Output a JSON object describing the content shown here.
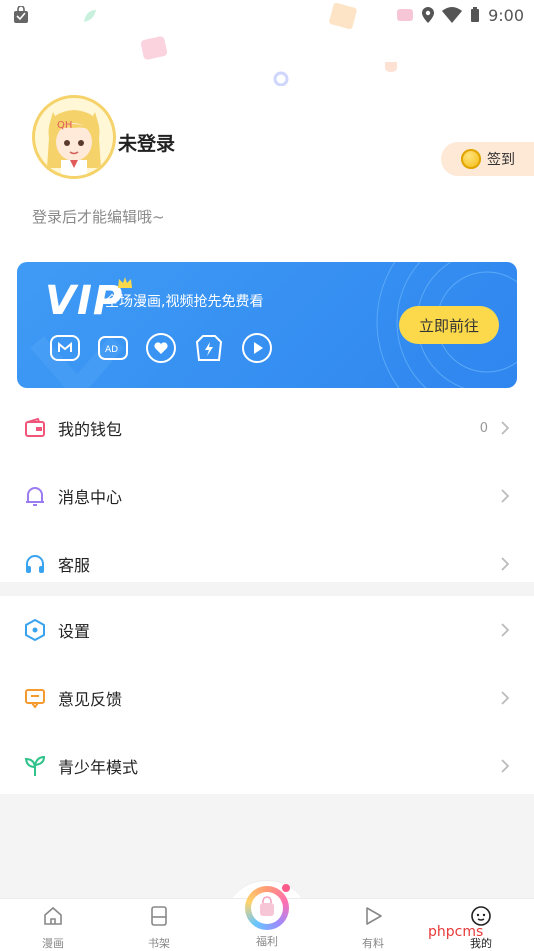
{
  "status_bar": {
    "time": "9:00"
  },
  "profile": {
    "username": "未登录",
    "hint": "登录后才能编辑哦~"
  },
  "checkin": {
    "label": "签到"
  },
  "vip": {
    "logo": "VIP",
    "subtitle": "全场漫画,视频抢先免费看",
    "button": "立即前往",
    "icons": [
      "m-icon",
      "ad-icon",
      "heart-icon",
      "lightning-icon",
      "play-icon"
    ]
  },
  "menu_group_1": [
    {
      "label": "我的钱包",
      "count": "0",
      "icon": "wallet-icon",
      "color": "#f0567a"
    },
    {
      "label": "消息中心",
      "count": "",
      "icon": "bell-icon",
      "color": "#9b7cf0"
    },
    {
      "label": "客服",
      "count": "",
      "icon": "headphones-icon",
      "color": "#3aa3f0"
    }
  ],
  "menu_group_2": [
    {
      "label": "设置",
      "icon": "hexagon-settings-icon",
      "color": "#3aa3f0"
    },
    {
      "label": "意见反馈",
      "icon": "feedback-icon",
      "color": "#f59a2e"
    },
    {
      "label": "青少年模式",
      "icon": "sprout-icon",
      "color": "#2fc28a"
    }
  ],
  "tabs": [
    {
      "label": "漫画",
      "icon": "home-icon",
      "active": false
    },
    {
      "label": "书架",
      "icon": "bookshelf-icon",
      "active": false
    },
    {
      "label": "福利",
      "icon": "gift-center-icon",
      "active": false
    },
    {
      "label": "有料",
      "icon": "play-tab-icon",
      "active": false
    },
    {
      "label": "我的",
      "icon": "face-icon",
      "active": true
    }
  ],
  "watermark": "phpcms",
  "colors": {
    "vip_blue": "#3f9bf5",
    "vip_button": "#fbd94a",
    "checkin_bg": "#fde9d6",
    "band_gray": "#f4f4f5"
  }
}
